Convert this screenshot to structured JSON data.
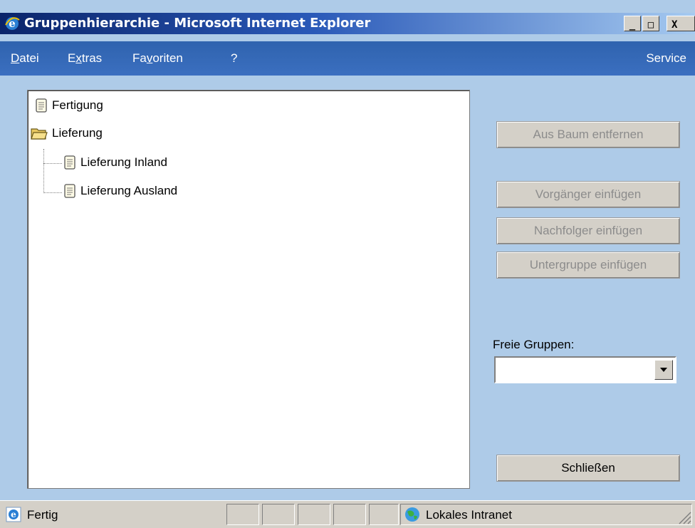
{
  "window": {
    "title": "Gruppenhierarchie - Microsoft Internet Explorer",
    "minimize": "_",
    "maximize": "□",
    "close": "X"
  },
  "menu": {
    "datei_ul": "D",
    "datei_rest": "atei",
    "extras_pre": "E",
    "extras_ul": "x",
    "extras_rest": "tras",
    "favoriten_pre": "Fa",
    "favoriten_ul": "v",
    "favoriten_rest": "oriten",
    "help": "?",
    "service": "Service"
  },
  "tree": {
    "items": [
      {
        "label": "Fertigung",
        "icon": "document-icon"
      },
      {
        "label": "Lieferung",
        "icon": "open-folder-icon"
      },
      {
        "label": "Lieferung Inland",
        "icon": "document-icon"
      },
      {
        "label": "Lieferung Ausland",
        "icon": "document-icon"
      }
    ]
  },
  "actions": {
    "aus_baum_entfernen": "Aus Baum entfernen",
    "vorgaenger_einfuegen": "Vorgänger einfügen",
    "nachfolger_einfuegen": "Nachfolger einfügen",
    "untergruppe_einfuegen": "Untergruppe einfügen",
    "schliessen": "Schließen"
  },
  "freie_gruppen": {
    "label": "Freie Gruppen:",
    "value": ""
  },
  "status": {
    "text": "Fertig",
    "zone": "Lokales Intranet"
  },
  "colors": {
    "titlebar_start": "#0a246a",
    "menubar": "#2f63ae",
    "panel_bg": "#aecbe8",
    "button_face": "#d4d0c8",
    "disabled_text": "#8c8c8c"
  }
}
